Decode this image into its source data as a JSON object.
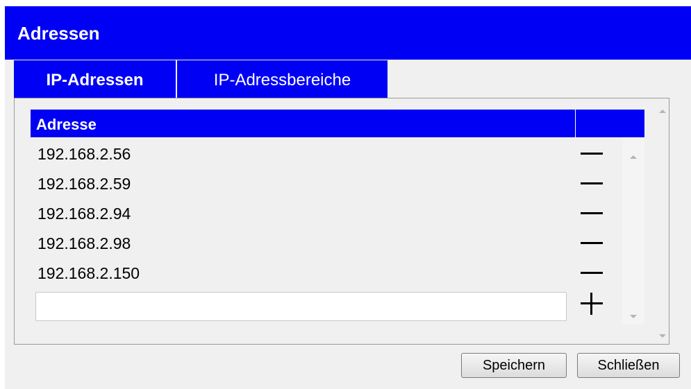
{
  "dialog": {
    "title": "Adressen"
  },
  "tabs": [
    {
      "label": "IP-Adressen",
      "active": true
    },
    {
      "label": "IP-Adressbereiche",
      "active": false
    }
  ],
  "table": {
    "header": "Adresse",
    "rows": [
      {
        "address": "192.168.2.56",
        "action_icon": "minus-icon"
      },
      {
        "address": "192.168.2.59",
        "action_icon": "minus-icon"
      },
      {
        "address": "192.168.2.94",
        "action_icon": "minus-icon"
      },
      {
        "address": "192.168.2.98",
        "action_icon": "minus-icon"
      },
      {
        "address": "192.168.2.150",
        "action_icon": "minus-icon"
      }
    ],
    "new_entry": {
      "value": "",
      "placeholder": "",
      "action_icon": "plus-icon"
    }
  },
  "buttons": {
    "save_label": "Speichern",
    "close_label": "Schließen"
  },
  "colors": {
    "accent": "#0000f5",
    "background": "#f0f0f0",
    "text": "#000000"
  }
}
